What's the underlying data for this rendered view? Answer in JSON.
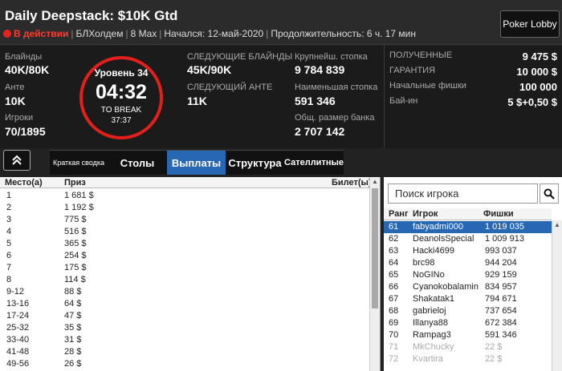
{
  "header": {
    "title": "Daily Deepstack: $10K Gtd",
    "status": "В действии",
    "game": "БЛХолдем",
    "max": "8 Max",
    "started": "Начался: 12-май-2020",
    "duration": "Продолжительность: 6 ч. 17 мин",
    "lobby_button": "Poker Lobby"
  },
  "stats": {
    "blinds_label": "Блайнды",
    "blinds": "40K/80K",
    "ante_label": "Анте",
    "ante": "10K",
    "players_label": "Игроки",
    "players": "70/1895",
    "next_blinds_label": "СЛЕДУЮЩИЕ БЛАЙНДЫ",
    "next_blinds": "45K/90K",
    "next_ante_label": "СЛЕДУЮЩИЙ АНТЕ",
    "next_ante": "11K",
    "largest_stack_label": "Крупнейш. стопка",
    "largest_stack": "9 784 839",
    "smallest_stack_label": "Наименьшая стопка",
    "smallest_stack": "591 346",
    "pot_label": "Общ. размер банка",
    "pot": "2 707 142"
  },
  "clock": {
    "level": "Уровень 34",
    "time": "04:32",
    "break_label": "TO BREAK",
    "break_time": "37:37"
  },
  "prize": {
    "received_label": "ПОЛУЧЕННЫЕ",
    "received": "9 475 $",
    "guarantee_label": "ГАРАНТИЯ",
    "guarantee": "10 000 $",
    "start_chips_label": "Начальные фишки",
    "start_chips": "100 000",
    "buyin_label": "Бай-ин",
    "buyin": "5 $+0,50 $"
  },
  "tabs": {
    "collapse_icon": "chevron-up-double",
    "summary": "Краткая сводка",
    "tables": "Столы",
    "payouts": "Выплаты",
    "structure": "Структура",
    "satellites": "Сателлитные"
  },
  "payouts": {
    "headers": [
      "Место(а)",
      "Приз",
      "Билет(ы)"
    ],
    "rows": [
      [
        "1",
        "1 681 $"
      ],
      [
        "2",
        "1 192 $"
      ],
      [
        "3",
        "775 $"
      ],
      [
        "4",
        "516 $"
      ],
      [
        "5",
        "365 $"
      ],
      [
        "6",
        "254 $"
      ],
      [
        "7",
        "175 $"
      ],
      [
        "8",
        "114 $"
      ],
      [
        "9-12",
        "88 $"
      ],
      [
        "13-16",
        "64 $"
      ],
      [
        "17-24",
        "47 $"
      ],
      [
        "25-32",
        "35 $"
      ],
      [
        "33-40",
        "31 $"
      ],
      [
        "41-48",
        "28 $"
      ],
      [
        "49-56",
        "26 $"
      ]
    ]
  },
  "players": {
    "search_placeholder": "Поиск игрока",
    "headers": [
      "Ранг",
      "Игрок",
      "Фишки"
    ],
    "rows": [
      [
        "61",
        "fabyadmi000",
        "1 019 035"
      ],
      [
        "62",
        "DeanolsSpecial",
        "1 009 913"
      ],
      [
        "63",
        "Hacki4699",
        "993 037"
      ],
      [
        "64",
        "brc98",
        "944 204"
      ],
      [
        "65",
        "NoGINo",
        "929 159"
      ],
      [
        "66",
        "Cyanokobalamin",
        "834 957"
      ],
      [
        "67",
        "Shakatak1",
        "794 671"
      ],
      [
        "68",
        "gabrieloj",
        "737 654"
      ],
      [
        "69",
        "Illanya88",
        "672 384"
      ],
      [
        "70",
        "Rampag3",
        "591 346"
      ],
      [
        "71",
        "MkChucky",
        "22 $"
      ],
      [
        "72",
        "Kvartira",
        "22 $"
      ]
    ]
  }
}
